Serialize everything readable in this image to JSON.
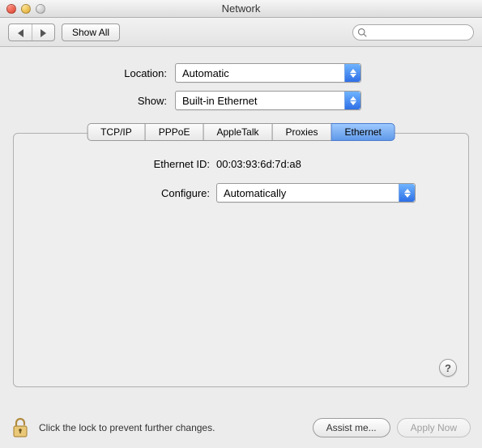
{
  "window": {
    "title": "Network"
  },
  "toolbar": {
    "show_all": "Show All",
    "search_placeholder": ""
  },
  "form": {
    "location_label": "Location:",
    "location_value": "Automatic",
    "show_label": "Show:",
    "show_value": "Built-in Ethernet"
  },
  "tabs": {
    "items": [
      "TCP/IP",
      "PPPoE",
      "AppleTalk",
      "Proxies",
      "Ethernet"
    ],
    "active_index": 4
  },
  "panel": {
    "ethernet_id_label": "Ethernet ID:",
    "ethernet_id_value": "00:03:93:6d:7d:a8",
    "configure_label": "Configure:",
    "configure_value": "Automatically",
    "help_label": "?"
  },
  "footer": {
    "lock_text": "Click the lock to prevent further changes.",
    "assist": "Assist me...",
    "apply": "Apply Now",
    "apply_enabled": false
  }
}
